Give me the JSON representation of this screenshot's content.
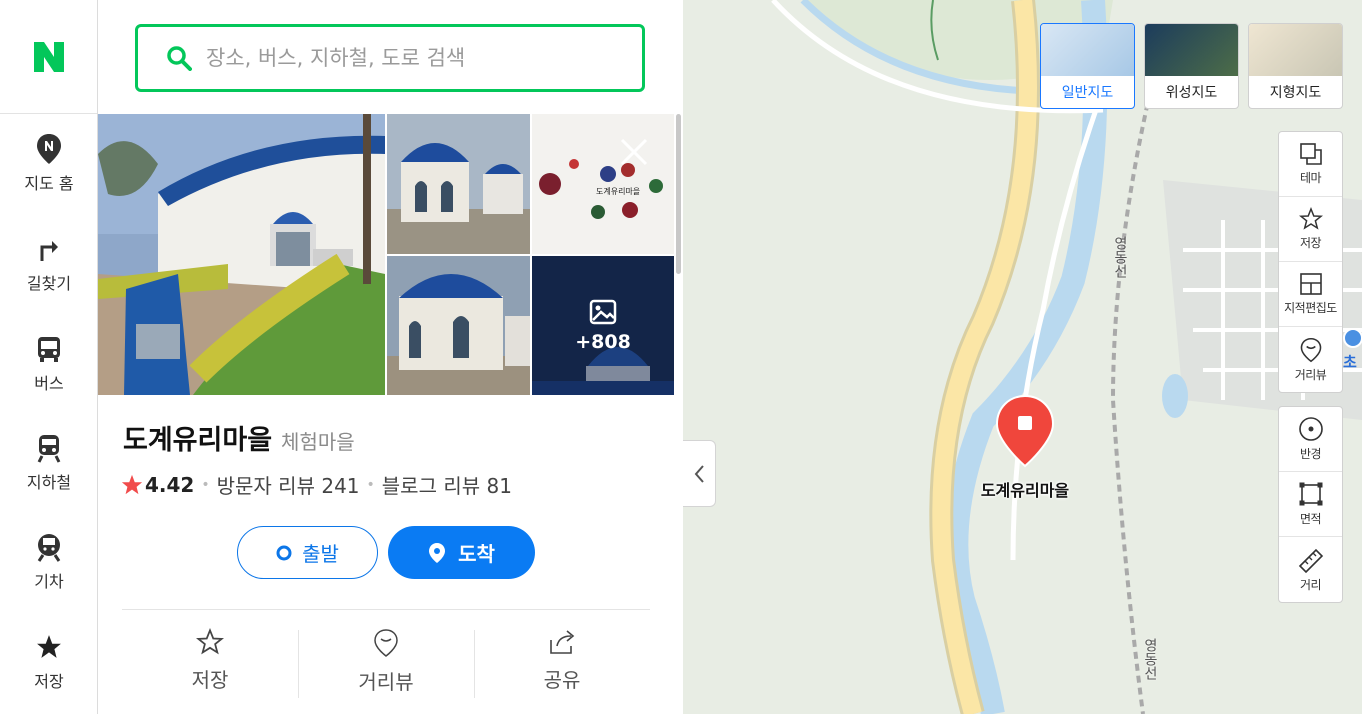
{
  "search": {
    "placeholder": "장소, 버스, 지하철, 도로 검색"
  },
  "nav": {
    "items": [
      {
        "label": "지도 홈"
      },
      {
        "label": "길찾기"
      },
      {
        "label": "버스"
      },
      {
        "label": "지하철"
      },
      {
        "label": "기차"
      },
      {
        "label": "저장"
      }
    ]
  },
  "place": {
    "name": "도계유리마을",
    "category": "체험마을",
    "rating": "4.42",
    "visitor_reviews": "방문자 리뷰 241",
    "blog_reviews": "블로그 리뷰 81",
    "photo_more": "+808",
    "sign_text": "도계유리마을"
  },
  "route": {
    "depart": "출발",
    "arrive": "도착"
  },
  "actions": [
    {
      "label": "저장"
    },
    {
      "label": "거리뷰"
    },
    {
      "label": "공유"
    }
  ],
  "map": {
    "types": [
      {
        "label": "일반지도",
        "active": true
      },
      {
        "label": "위성지도"
      },
      {
        "label": "지형지도"
      }
    ],
    "tools1": [
      {
        "label": "테마"
      },
      {
        "label": "저장"
      },
      {
        "label": "지적편집도"
      },
      {
        "label": "거리뷰"
      }
    ],
    "tools2": [
      {
        "label": "반경"
      },
      {
        "label": "면적"
      },
      {
        "label": "거리"
      }
    ],
    "marker_label": "도계유리마을",
    "rail_label_1": "영동선",
    "rail_label_2": "영동선",
    "poi_partial": "초"
  },
  "colors": {
    "brand": "#03c75a",
    "primary": "#0a7bf3",
    "marker": "#f0463c"
  }
}
